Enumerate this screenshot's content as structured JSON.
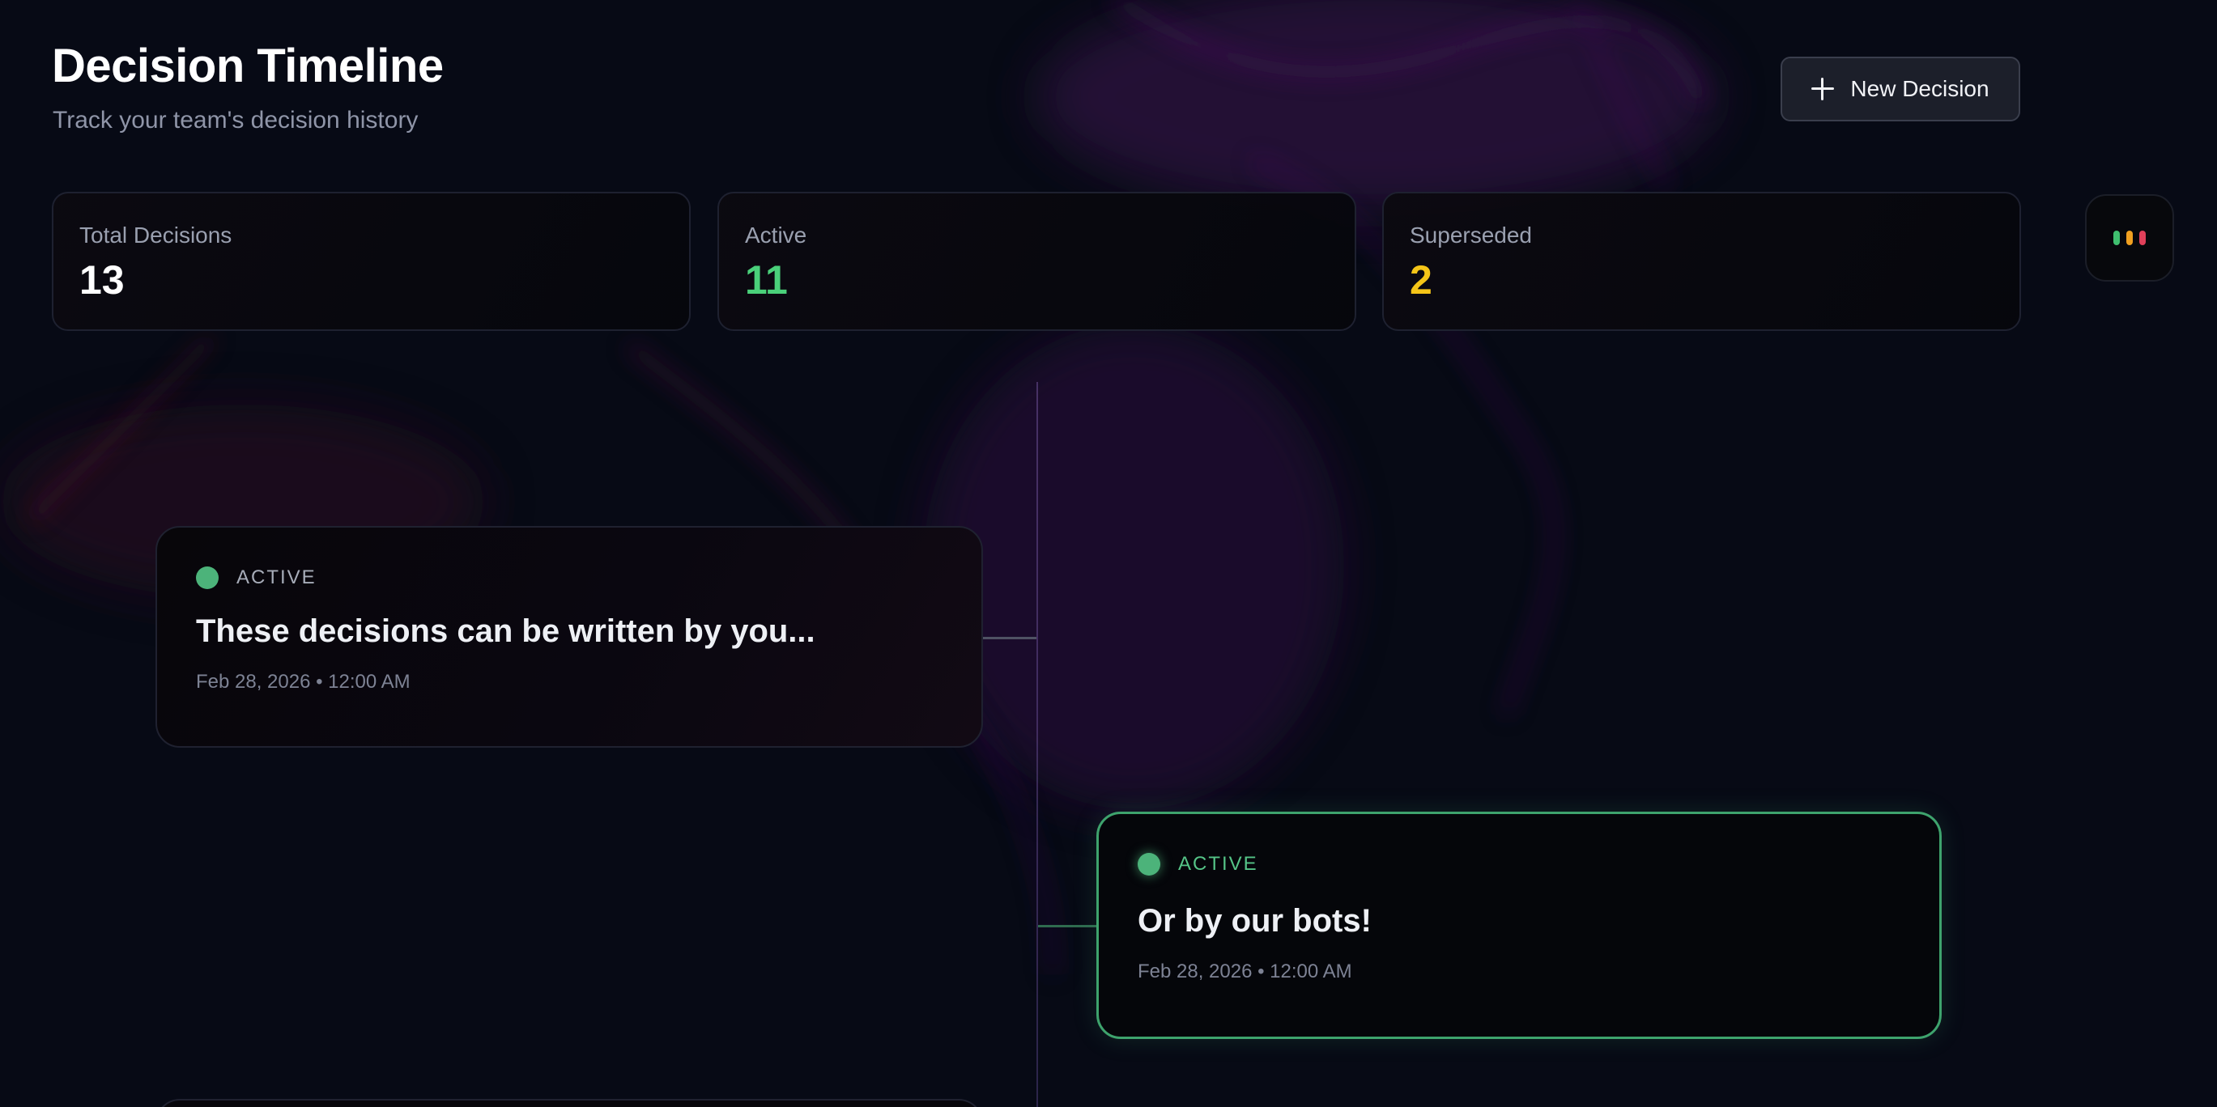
{
  "header": {
    "title": "Decision Timeline",
    "subtitle": "Track your team's decision history",
    "new_button_label": "New Decision",
    "new_button_icon": "plus-icon"
  },
  "stats": [
    {
      "label": "Total Decisions",
      "value": "13",
      "color": "#ffffff"
    },
    {
      "label": "Active",
      "value": "11",
      "color": "#4ad07a"
    },
    {
      "label": "Superseded",
      "value": "2",
      "color": "#f5c518"
    }
  ],
  "status_dots_button": {
    "icon": "status-dots-icon",
    "colors": [
      "#3fbf6f",
      "#f0a020",
      "#e0405a"
    ]
  },
  "timeline": {
    "items": [
      {
        "status": "ACTIVE",
        "title": "These decisions can be written by you...",
        "date": "Feb 28, 2026 • 12:00 AM",
        "status_color": "#4cb37a"
      },
      {
        "status": "ACTIVE",
        "title": "Or by our bots!",
        "date": "Feb 28, 2026 • 12:00 AM",
        "status_color": "#4cb37a",
        "highlighted": true
      }
    ]
  },
  "colors": {
    "background": "#070a15",
    "accent_green": "#3ea36d",
    "superseded_yellow": "#f5c518"
  }
}
